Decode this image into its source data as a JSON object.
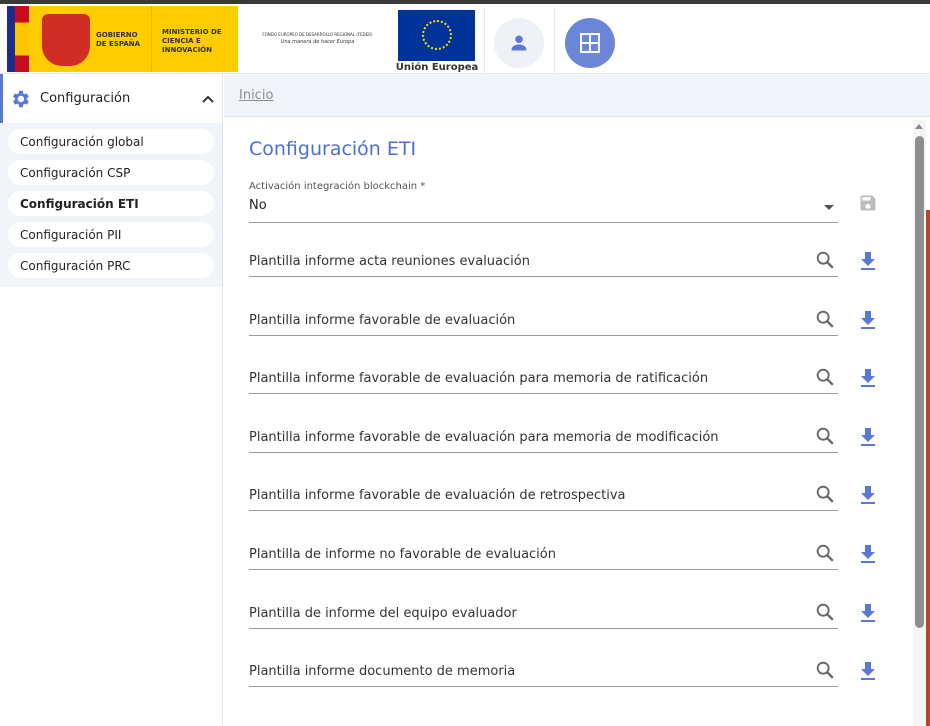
{
  "header": {
    "gobierno_text": "GOBIERNO DE ESPAÑA",
    "ministerio_text": "MINISTERIO DE CIENCIA E INNOVACIÓN",
    "feder_title": "FONDO EUROPEO DE DESARROLLO REGIONAL (FEDER)",
    "feder_motto": "Una manera de hacer Europa",
    "eu_label": "Unión Europea",
    "user_icon": "person-icon",
    "apps_icon": "grid-icon",
    "accent": "#6b86d6"
  },
  "sidebar": {
    "section": "Configuración",
    "items": [
      {
        "label": "Configuración global",
        "active": false
      },
      {
        "label": "Configuración CSP",
        "active": false
      },
      {
        "label": "Configuración ETI",
        "active": true
      },
      {
        "label": "Configuración PII",
        "active": false
      },
      {
        "label": "Configuración PRC",
        "active": false
      }
    ]
  },
  "breadcrumb": {
    "home": "Inicio"
  },
  "main": {
    "title": "Configuración ETI",
    "blockchain": {
      "label": "Activación integración blockchain *",
      "value": "No"
    },
    "fields": [
      "Plantilla informe acta reuniones evaluación",
      "Plantilla informe favorable de evaluación",
      "Plantilla informe favorable de evaluación para memoria de ratificación",
      "Plantilla informe favorable de evaluación para memoria de modificación",
      "Plantilla informe favorable de evaluación de retrospectiva",
      "Plantilla de informe no favorable de evaluación",
      "Plantilla de informe del equipo evaluador",
      "Plantilla informe documento de memoria"
    ]
  }
}
